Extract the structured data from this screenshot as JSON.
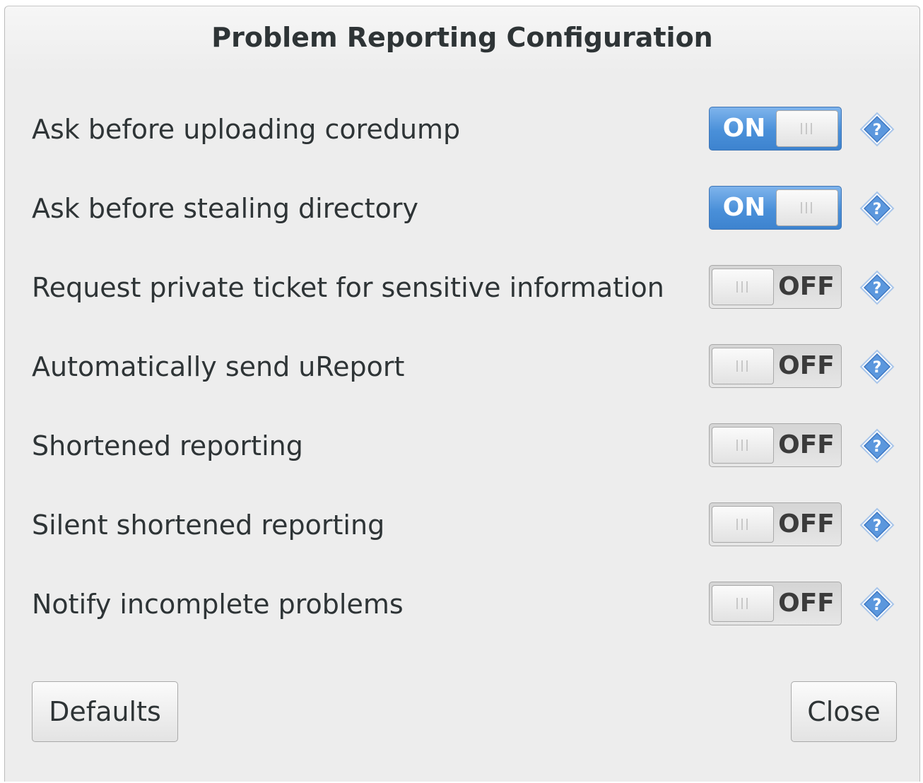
{
  "dialog": {
    "title": "Problem Reporting Configuration"
  },
  "options": [
    {
      "label": "Ask before uploading coredump",
      "state": "ON",
      "on": true
    },
    {
      "label": "Ask before stealing directory",
      "state": "ON",
      "on": true
    },
    {
      "label": "Request private ticket for sensitive information",
      "state": "OFF",
      "on": false
    },
    {
      "label": "Automatically send uReport",
      "state": "OFF",
      "on": false
    },
    {
      "label": "Shortened reporting",
      "state": "OFF",
      "on": false
    },
    {
      "label": "Silent shortened reporting",
      "state": "OFF",
      "on": false
    },
    {
      "label": "Notify incomplete problems",
      "state": "OFF",
      "on": false
    }
  ],
  "buttons": {
    "defaults_label": "Defaults",
    "close_label": "Close"
  },
  "icons": {
    "help": "help-icon"
  },
  "colors": {
    "switch_on": "#4a90d9",
    "help_icon": "#4a90d9",
    "background": "#ededed"
  }
}
